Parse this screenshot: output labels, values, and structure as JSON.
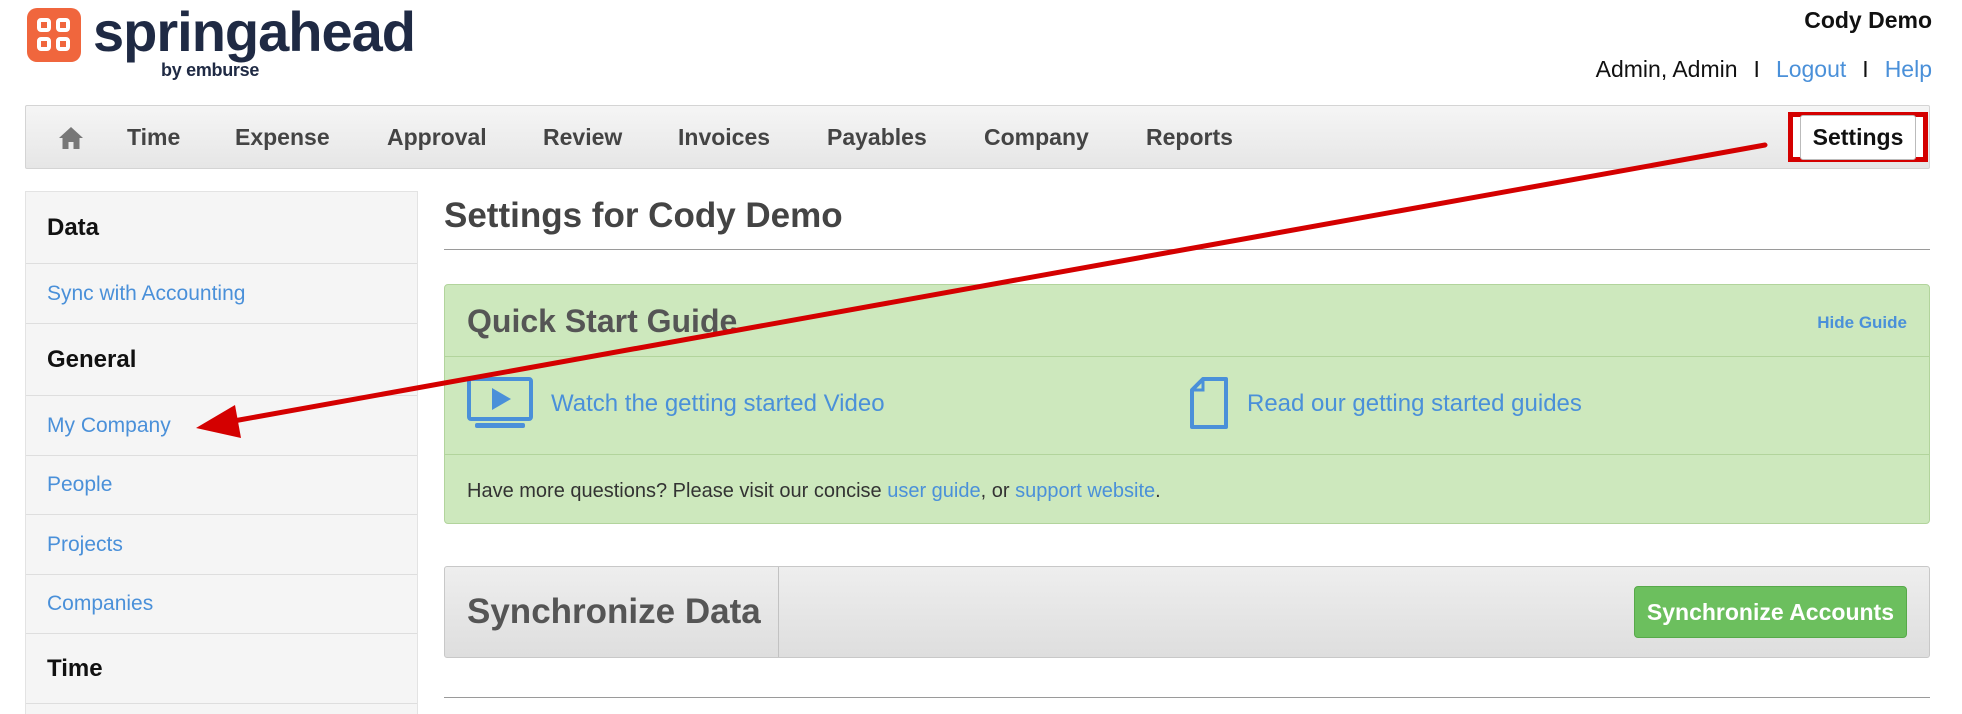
{
  "brand": {
    "name": "springahead",
    "sub": "by emburse",
    "color": "#f0663d"
  },
  "user": {
    "company": "Cody Demo",
    "role": "Admin, Admin",
    "separator": "I",
    "logout_label": "Logout",
    "help_label": "Help"
  },
  "nav": {
    "home_icon": "home-icon",
    "items": [
      "Time",
      "Expense",
      "Approval",
      "Review",
      "Invoices",
      "Payables",
      "Company",
      "Reports"
    ],
    "settings_label": "Settings",
    "highlight_color": "#d40000"
  },
  "sidebar": {
    "sections": [
      {
        "heading": "Data",
        "links": [
          "Sync with Accounting"
        ]
      },
      {
        "heading": "General",
        "links": [
          "My Company",
          "People",
          "Projects",
          "Companies"
        ]
      },
      {
        "heading": "Time",
        "links": []
      }
    ]
  },
  "main": {
    "title": "Settings for Cody Demo",
    "guide": {
      "title": "Quick Start Guide",
      "hide_label": "Hide Guide",
      "video_label": "Watch the getting started Video",
      "guides_label": "Read our getting started guides",
      "help_prefix": "Have more questions? Please visit our concise ",
      "user_guide_label": "user guide",
      "help_middle": ", or ",
      "support_label": "support website",
      "help_suffix": ".",
      "background_color": "#cde8bd"
    },
    "sync": {
      "title": "Synchronize Data",
      "button_label": "Synchronize Accounts",
      "button_color": "#6cbf5e"
    }
  },
  "annotation": {
    "type": "arrow",
    "from": "settings-button",
    "to": "sidebar-item-my-company",
    "color": "#d40000"
  },
  "colors": {
    "link": "#4a90d9"
  }
}
